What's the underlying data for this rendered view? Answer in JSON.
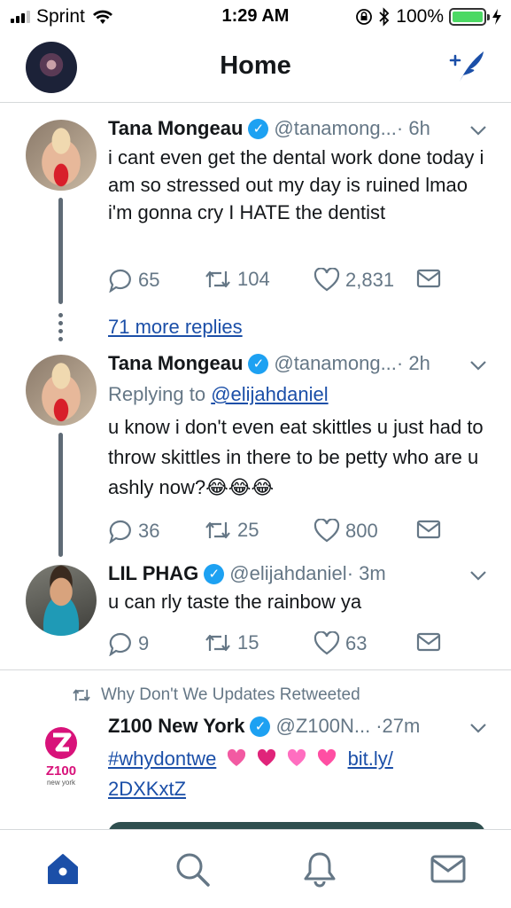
{
  "status_bar": {
    "carrier": "Sprint",
    "time": "1:29 AM",
    "battery_percent": "100%",
    "battery_level": 1.0
  },
  "header": {
    "title": "Home"
  },
  "tweets": [
    {
      "name": "Tana Mongeau",
      "handle": "@tanamong...",
      "time": "· 6h",
      "text": "i cant even get the dental work done today i am so stressed out my day is ruined lmao i'm gonna cry I HATE the dentist",
      "replies": "65",
      "retweets": "104",
      "likes": "2,831"
    },
    {
      "name": "Tana Mongeau",
      "handle": "@tanamong...",
      "time": "· 2h",
      "replying_prefix": "Replying to",
      "replying_to": "@elijahdaniel",
      "text": "u know i don't even eat skittles u just had to throw skittles in there to be petty who are u ashly now?",
      "emoji": "😂😂😂",
      "replies": "36",
      "retweets": "25",
      "likes": "800"
    },
    {
      "name": "LIL PHAG",
      "handle": "@elijahdaniel",
      "time": "· 3m",
      "text": "u can rly taste the rainbow ya",
      "replies": "9",
      "retweets": "15",
      "likes": "63"
    },
    {
      "retweet_label": "Why Don't We Updates Retweeted",
      "name": "Z100 New York",
      "handle": "@Z100N...",
      "time": "·27m",
      "hashtag": "#whydontwe",
      "link_part1": "bit.ly/",
      "link_part2": "2DXKxtZ",
      "logo_text": "Z100",
      "logo_sub": "new york"
    }
  ],
  "more_replies": "71 more replies",
  "colors": {
    "twitter_blue": "#1da1f2",
    "link_blue": "#1b4fa8",
    "nav_active": "#1b4fa8",
    "gray_text": "#657786",
    "heart_pink": "#e0245e"
  },
  "icons": {
    "compose": "compose-tweet-icon",
    "home": "home-icon",
    "search": "search-icon",
    "notifications": "bell-icon",
    "messages": "envelope-icon"
  }
}
